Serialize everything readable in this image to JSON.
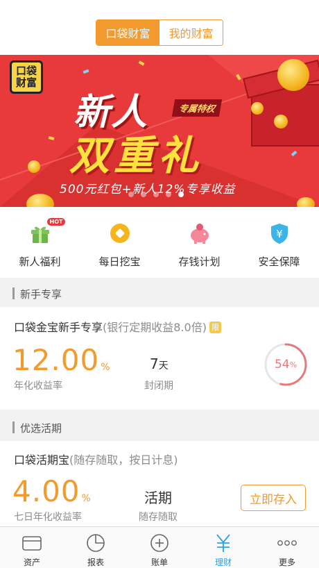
{
  "header": {
    "tabs": [
      {
        "label": "口袋财富",
        "active": true
      },
      {
        "label": "我的财富",
        "active": false
      }
    ]
  },
  "banner": {
    "logo_text": "口袋财富",
    "line1": "新人",
    "tag": "专属特权",
    "line2": "双重礼",
    "line3": "500元红包+新人12%专享收益",
    "slides_total": 5,
    "active_slide": 5
  },
  "quick_links": [
    {
      "label": "新人福利",
      "icon": "gift-icon",
      "badge": "HOT"
    },
    {
      "label": "每日挖宝",
      "icon": "coin-icon"
    },
    {
      "label": "存钱计划",
      "icon": "piggy-bank-icon"
    },
    {
      "label": "安全保障",
      "icon": "shield-yen-icon"
    }
  ],
  "sections": {
    "newbie": {
      "header": "新手专享",
      "product_name": "口袋金宝新手专享",
      "product_sub": "(银行定期收益8.0倍)",
      "product_badge": "限",
      "rate": "12.00",
      "rate_unit": "%",
      "rate_label": "年化收益率",
      "term_value": "7",
      "term_unit": "天",
      "term_label": "封闭期",
      "progress_value": "54",
      "progress_unit": "%",
      "progress_percent": 54
    },
    "current": {
      "header": "优选活期",
      "product_name": "口袋活期宝",
      "product_sub": "(随存随取，按日计息)",
      "rate": "4.00",
      "rate_unit": "%",
      "rate_label": "七日年化收益率",
      "term_value": "活期",
      "term_label": "随存随取",
      "button_label": "立即存入"
    }
  },
  "tabbar": [
    {
      "label": "资产",
      "icon": "wallet-icon",
      "active": false
    },
    {
      "label": "报表",
      "icon": "pie-chart-icon",
      "active": false
    },
    {
      "label": "账单",
      "icon": "add-circle-icon",
      "active": false
    },
    {
      "label": "理财",
      "icon": "yen-icon",
      "active": true
    },
    {
      "label": "更多",
      "icon": "more-icon",
      "active": false
    }
  ],
  "colors": {
    "accent": "#f39a2e",
    "banner_red": "#e83a3a",
    "tab_active": "#2aa2e8",
    "progress": "#e8797a"
  }
}
